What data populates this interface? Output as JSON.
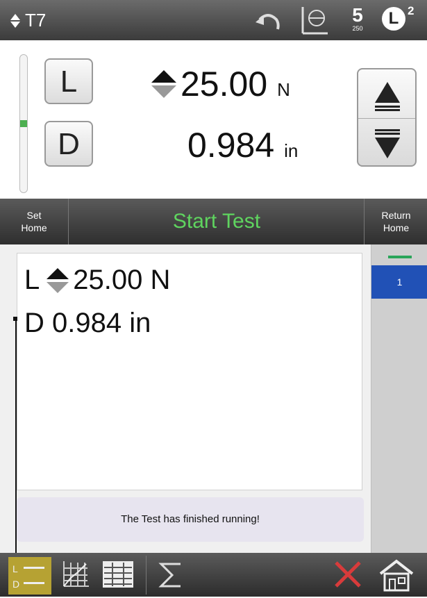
{
  "header": {
    "test_name": "T7",
    "speed_value": "5",
    "speed_sub": "250",
    "load_badge": "L",
    "load_badge_sup": "2"
  },
  "readout": {
    "load_button": "L",
    "disp_button": "D",
    "load_value": "25.00",
    "load_unit": "N",
    "disp_value": "0.984",
    "disp_unit": "in",
    "rail_level": 0.5
  },
  "actionbar": {
    "set_home_line1": "Set",
    "set_home_line2": "Home",
    "start_test": "Start Test",
    "return_home_line1": "Return",
    "return_home_line2": "Home"
  },
  "results": {
    "load_label": "L",
    "load_value": "25.00 N",
    "disp_line": "D 0.984 in",
    "message": "The Test has finished running!"
  },
  "testlist": {
    "items": [
      "1"
    ]
  },
  "colors": {
    "start_green": "#5fd45f",
    "selected_blue": "#2151b6",
    "active_tab_yellow": "#b6a233",
    "cancel_red": "#d83b3b"
  },
  "icons": {
    "header": [
      "updown-icon",
      "undo-icon",
      "tare-icon",
      "speed-icon",
      "load-badge-icon"
    ],
    "bottom": [
      "load-display-icon",
      "graph-icon",
      "table-icon",
      "sigma-icon",
      "cancel-icon",
      "home-icon"
    ]
  }
}
